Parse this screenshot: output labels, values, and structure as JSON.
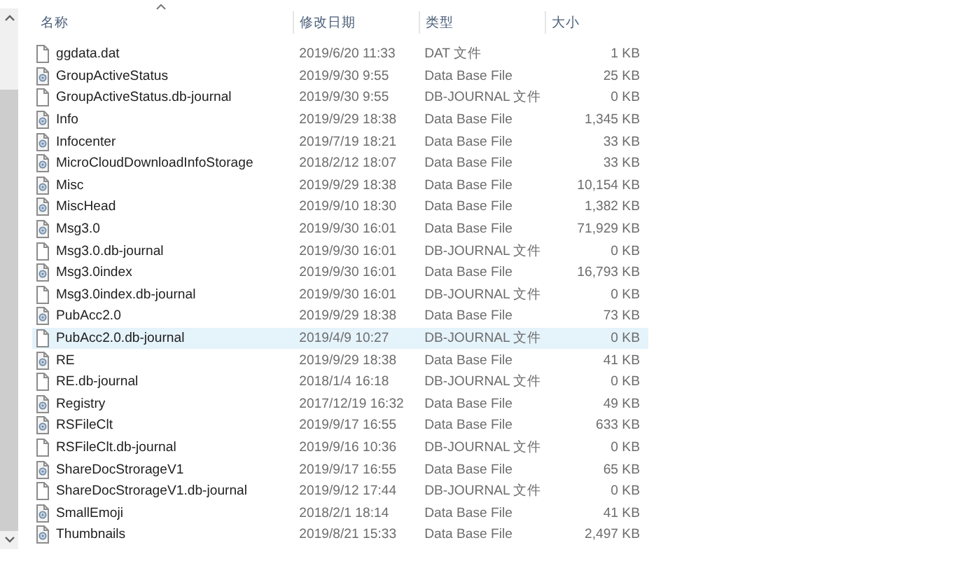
{
  "columns": [
    {
      "label": "名称",
      "sorted": true
    },
    {
      "label": "修改日期",
      "sorted": false
    },
    {
      "label": "类型",
      "sorted": false
    },
    {
      "label": "大小",
      "sorted": false
    }
  ],
  "rows": [
    {
      "name": "ggdata.dat",
      "date": "2019/6/20 11:33",
      "type": "DAT 文件",
      "size": "1 KB",
      "kind": "plain",
      "selected": false
    },
    {
      "name": "GroupActiveStatus",
      "date": "2019/9/30 9:55",
      "type": "Data Base File",
      "size": "25 KB",
      "kind": "db",
      "selected": false
    },
    {
      "name": "GroupActiveStatus.db-journal",
      "date": "2019/9/30 9:55",
      "type": "DB-JOURNAL 文件",
      "size": "0 KB",
      "kind": "plain",
      "selected": false
    },
    {
      "name": "Info",
      "date": "2019/9/29 18:38",
      "type": "Data Base File",
      "size": "1,345 KB",
      "kind": "db",
      "selected": false
    },
    {
      "name": "Infocenter",
      "date": "2019/7/19 18:21",
      "type": "Data Base File",
      "size": "33 KB",
      "kind": "db",
      "selected": false
    },
    {
      "name": "MicroCloudDownloadInfoStorage",
      "date": "2018/2/12 18:07",
      "type": "Data Base File",
      "size": "33 KB",
      "kind": "db",
      "selected": false
    },
    {
      "name": "Misc",
      "date": "2019/9/29 18:38",
      "type": "Data Base File",
      "size": "10,154 KB",
      "kind": "db",
      "selected": false
    },
    {
      "name": "MiscHead",
      "date": "2019/9/10 18:30",
      "type": "Data Base File",
      "size": "1,382 KB",
      "kind": "db",
      "selected": false
    },
    {
      "name": "Msg3.0",
      "date": "2019/9/30 16:01",
      "type": "Data Base File",
      "size": "71,929 KB",
      "kind": "db",
      "selected": false
    },
    {
      "name": "Msg3.0.db-journal",
      "date": "2019/9/30 16:01",
      "type": "DB-JOURNAL 文件",
      "size": "0 KB",
      "kind": "plain",
      "selected": false
    },
    {
      "name": "Msg3.0index",
      "date": "2019/9/30 16:01",
      "type": "Data Base File",
      "size": "16,793 KB",
      "kind": "db",
      "selected": false
    },
    {
      "name": "Msg3.0index.db-journal",
      "date": "2019/9/30 16:01",
      "type": "DB-JOURNAL 文件",
      "size": "0 KB",
      "kind": "plain",
      "selected": false
    },
    {
      "name": "PubAcc2.0",
      "date": "2019/9/29 18:38",
      "type": "Data Base File",
      "size": "73 KB",
      "kind": "db",
      "selected": false
    },
    {
      "name": "PubAcc2.0.db-journal",
      "date": "2019/4/9 10:27",
      "type": "DB-JOURNAL 文件",
      "size": "0 KB",
      "kind": "plain",
      "selected": true
    },
    {
      "name": "RE",
      "date": "2019/9/29 18:38",
      "type": "Data Base File",
      "size": "41 KB",
      "kind": "db",
      "selected": false
    },
    {
      "name": "RE.db-journal",
      "date": "2018/1/4 16:18",
      "type": "DB-JOURNAL 文件",
      "size": "0 KB",
      "kind": "plain",
      "selected": false
    },
    {
      "name": "Registry",
      "date": "2017/12/19 16:32",
      "type": "Data Base File",
      "size": "49 KB",
      "kind": "db",
      "selected": false
    },
    {
      "name": "RSFileClt",
      "date": "2019/9/17 16:55",
      "type": "Data Base File",
      "size": "633 KB",
      "kind": "db",
      "selected": false
    },
    {
      "name": "RSFileClt.db-journal",
      "date": "2019/9/16 10:36",
      "type": "DB-JOURNAL 文件",
      "size": "0 KB",
      "kind": "plain",
      "selected": false
    },
    {
      "name": "ShareDocStrorageV1",
      "date": "2019/9/17 16:55",
      "type": "Data Base File",
      "size": "65 KB",
      "kind": "db",
      "selected": false
    },
    {
      "name": "ShareDocStrorageV1.db-journal",
      "date": "2019/9/12 17:44",
      "type": "DB-JOURNAL 文件",
      "size": "0 KB",
      "kind": "plain",
      "selected": false
    },
    {
      "name": "SmallEmoji",
      "date": "2018/2/1 18:14",
      "type": "Data Base File",
      "size": "41 KB",
      "kind": "db",
      "selected": false
    },
    {
      "name": "Thumbnails",
      "date": "2019/8/21 15:33",
      "type": "Data Base File",
      "size": "2,497 KB",
      "kind": "db",
      "selected": false
    }
  ]
}
